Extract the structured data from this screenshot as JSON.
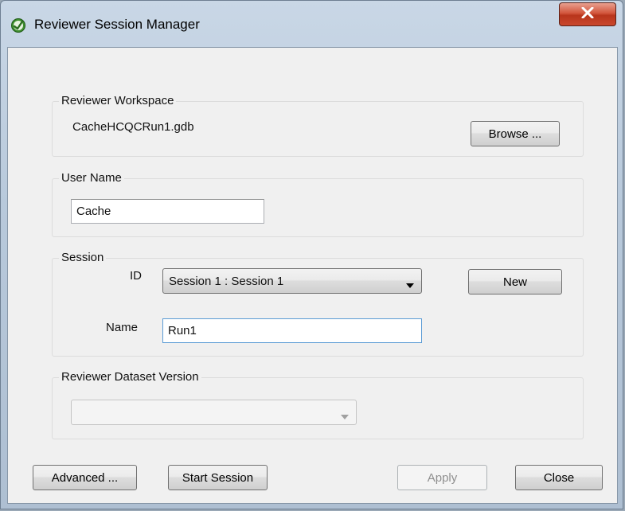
{
  "window": {
    "title": "Reviewer Session Manager",
    "icon": "reviewer-check-icon",
    "close_icon": "close-x-icon"
  },
  "workspace": {
    "legend": "Reviewer Workspace",
    "path": "CacheHCQCRun1.gdb",
    "browse_label": "Browse ..."
  },
  "user": {
    "legend": "User Name",
    "value": "Cache"
  },
  "session": {
    "legend": "Session",
    "id_label": "ID",
    "id_selected": "Session 1 : Session 1",
    "new_label": "New",
    "name_label": "Name",
    "name_value": "Run1"
  },
  "dataset_version": {
    "legend": "Reviewer Dataset Version",
    "selected": ""
  },
  "footer": {
    "advanced_label": "Advanced ...",
    "start_label": "Start Session",
    "apply_label": "Apply",
    "close_label": "Close"
  },
  "colors": {
    "titlebar": "#b8c9db",
    "client_bg": "#f0f0f0",
    "close_button": "#c9472c",
    "focus_border": "#5b9bd5",
    "disabled_text": "#8f8f8f"
  }
}
